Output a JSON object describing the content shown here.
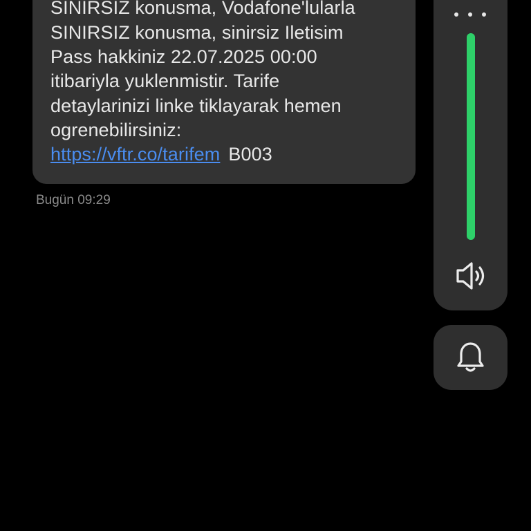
{
  "message": {
    "lines": [
      "SINIRSIZ konusma, Vodafone'lularla",
      "SINIRSIZ konusma, sinirsiz Iletisim",
      "Pass hakkiniz 22.07.2025 00:00",
      "itibariyla yuklenmistir. Tarife",
      "detaylarinizi linke tiklayarak hemen",
      "ogrenebilirsiniz:"
    ],
    "link": "https://vftr.co/tarifem",
    "code": "B003",
    "timestamp": "Bugün 09:29"
  },
  "volume_panel": {
    "more_icon": "more-horizontal-icon",
    "level_fraction": 1.0,
    "fill_color": "#2ed069",
    "speaker_icon": "speaker-icon"
  },
  "sound_mode": {
    "icon": "bell-icon"
  }
}
